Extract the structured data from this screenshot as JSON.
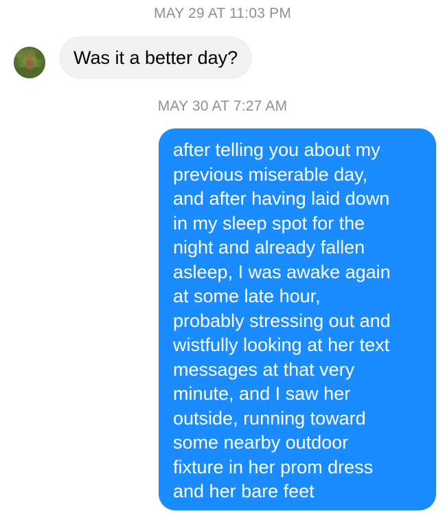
{
  "thread": {
    "timestamp_1": "MAY 29 AT 11:03 PM",
    "timestamp_2": "MAY 30 AT 7:27 AM"
  },
  "incoming_message": {
    "text": "Was it a better day?",
    "avatar_icon": "deer-photo-avatar"
  },
  "outgoing_message": {
    "lines": [
      "after telling you about my",
      "previous miserable day,",
      "and after having laid down",
      "in my sleep spot for the",
      "night and already fallen",
      "asleep, I was awake again",
      "at some late hour,",
      "probably stressing out and",
      "wistfully looking at her text",
      "messages at that very",
      "minute, and I saw her",
      "outside, running toward",
      "some nearby outdoor",
      "fixture in her prom dress",
      "and her bare feet"
    ]
  },
  "colors": {
    "outgoing_bubble": "#1a8cff",
    "incoming_bubble": "#f1f1f1",
    "timestamp": "#8e8e93"
  }
}
